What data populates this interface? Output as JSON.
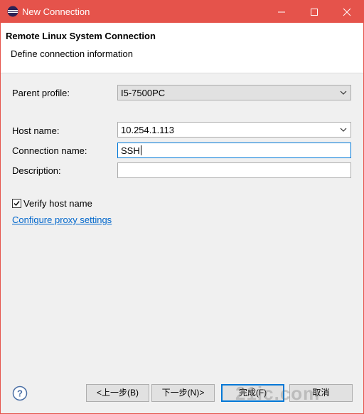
{
  "window": {
    "title": "New Connection",
    "app_icon": "eclipse-icon",
    "controls": [
      "minimize-icon",
      "maximize-icon",
      "close-icon"
    ]
  },
  "banner": {
    "heading": "Remote Linux System Connection",
    "description": "Define connection information"
  },
  "form": {
    "parent_profile_label": "Parent profile:",
    "parent_profile_value": "I5-7500PC",
    "host_name_label": "Host name:",
    "host_name_value": "10.254.1.113",
    "connection_name_label": "Connection name:",
    "connection_name_value": "SSH",
    "description_label": "Description:",
    "description_value": "",
    "verify_label": "Verify host name",
    "verify_checked": true,
    "proxy_link": "Configure proxy settings"
  },
  "buttons": {
    "back": "<上一步(B)",
    "next": "下一步(N)>",
    "finish": "完成(F)",
    "cancel": "取消",
    "help_icon": "help-icon"
  },
  "watermark": "21ic.com",
  "colors": {
    "titlebar": "#e5534b",
    "link": "#0066cc",
    "focus": "#0078d7"
  }
}
